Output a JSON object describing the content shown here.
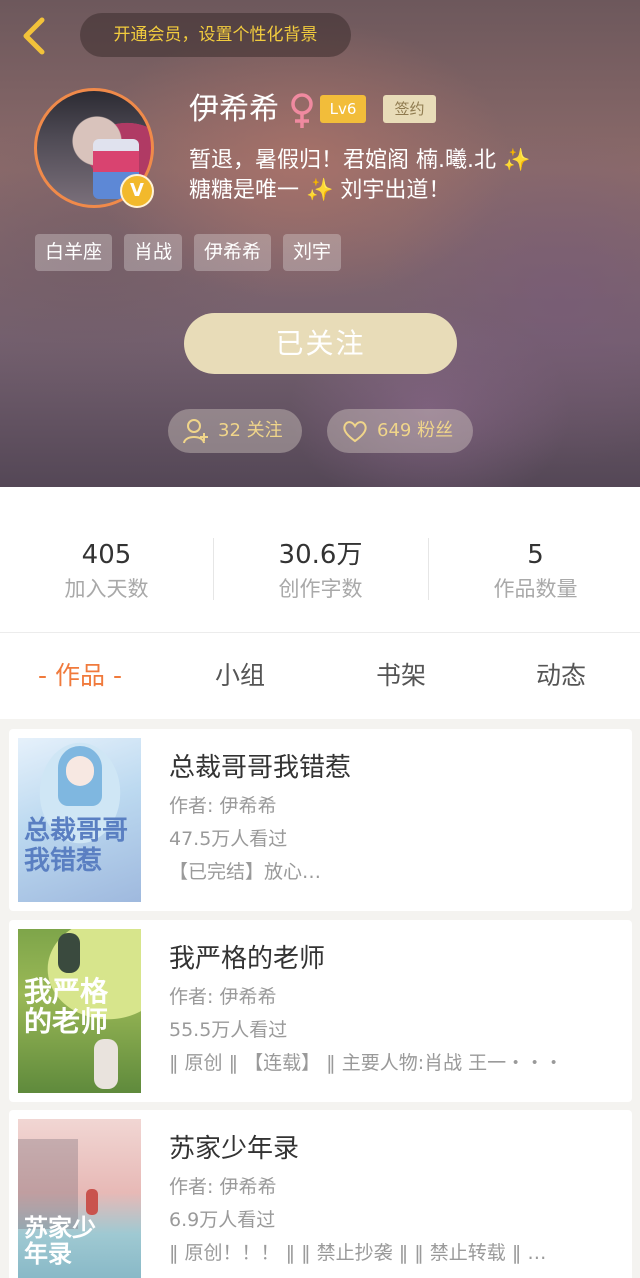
{
  "header": {
    "vip_banner": "开通会员，设置个性化背景",
    "username": "伊希希",
    "level": "Lv6",
    "sign_label": "签约",
    "verified_badge": "V",
    "bio_line1": "暂退，暑假归！君婠阁 楠.曦.北",
    "bio_line2a": "糖糖是唯一",
    "bio_line2b": "刘宇出道！",
    "sparkle": "✨",
    "tags": [
      "白羊座",
      "肖战",
      "伊希希",
      "刘宇"
    ],
    "follow_button": "已关注",
    "following": "32 关注",
    "fans": "649 粉丝"
  },
  "stats": [
    {
      "value": "405",
      "label": "加入天数"
    },
    {
      "value": "30.6万",
      "label": "创作字数"
    },
    {
      "value": "5",
      "label": "作品数量"
    }
  ],
  "tabs": [
    "- 作品 -",
    "小组",
    "书架",
    "动态"
  ],
  "works": [
    {
      "title": "总裁哥哥我错惹",
      "author": "作者: 伊希希",
      "views": "47.5万人看过",
      "desc": "【已完结】放心…",
      "cover_text": "总裁哥哥我错惹"
    },
    {
      "title": "我严格的老师",
      "author": "作者: 伊希希",
      "views": "55.5万人看过",
      "desc": "‖ 原创 ‖ 【连载】 ‖ 主要人物:肖战  王一・・・",
      "cover_text": "我严格的老师"
    },
    {
      "title": "苏家少年录",
      "author": "作者: 伊希希",
      "views": "6.9万人看过",
      "desc": "‖ 原创！！！ ‖ ‖ 禁止抄袭 ‖ ‖ 禁止转载 ‖ …",
      "cover_text": "苏家少年录"
    }
  ],
  "colors": {
    "accent_orange": "#f07a3c",
    "vip_yellow": "#f2cc3e",
    "follow_button_bg": "#e8dcb8",
    "level_badge": "#f2bd3a"
  },
  "icons": [
    "back-arrow-icon",
    "female-icon",
    "add-user-icon",
    "heart-icon",
    "verified-v-icon"
  ]
}
